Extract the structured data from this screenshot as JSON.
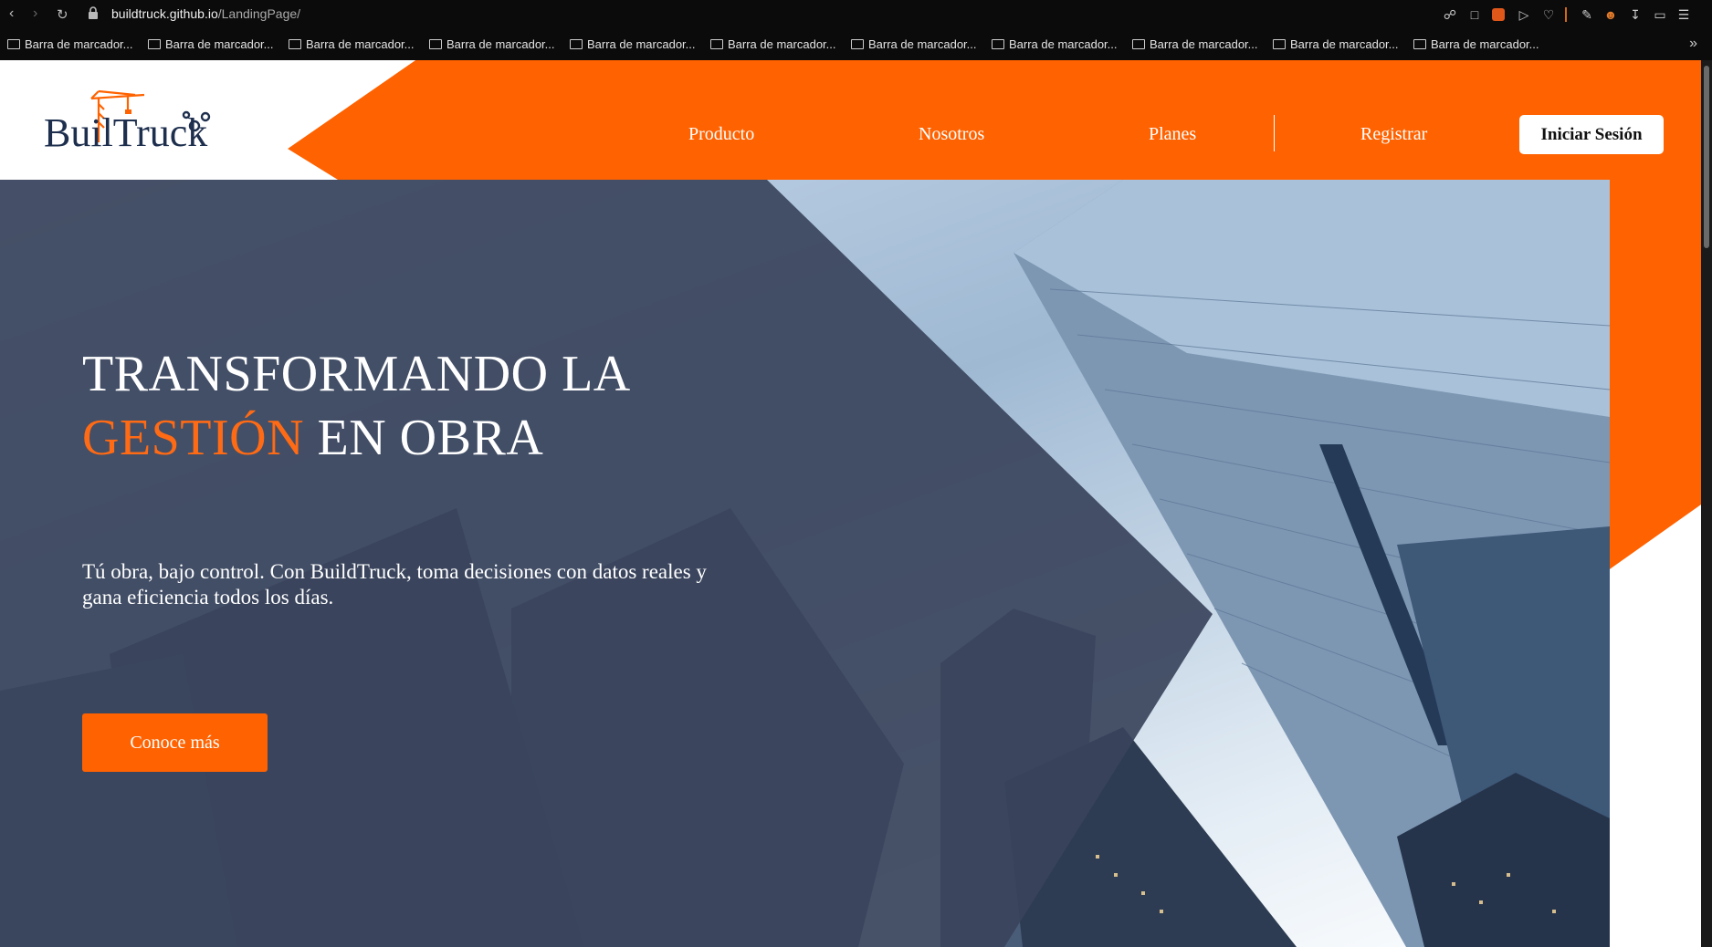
{
  "browser": {
    "url_host": "buildtruck.github.io",
    "url_path": "/LandingPage/",
    "bookmarks": [
      "Barra de marcador...",
      "Barra de marcador...",
      "Barra de marcador...",
      "Barra de marcador...",
      "Barra de marcador...",
      "Barra de marcador...",
      "Barra de marcador...",
      "Barra de marcador...",
      "Barra de marcador...",
      "Barra de marcador...",
      "Barra de marcador..."
    ]
  },
  "header": {
    "logo_text": "BuilTruck",
    "nav": {
      "product": "Producto",
      "about": "Nosotros",
      "plans": "Planes",
      "register": "Registrar"
    },
    "login_label": "Iniciar Sesión"
  },
  "hero": {
    "title_line1": "TRANSFORMANDO LA",
    "title_accent": "GESTIÓN",
    "title_line2_rest": " EN OBRA",
    "subtitle": "Tú obra, bajo control. Con BuildTruck, toma decisiones con datos reales y gana eficiencia todos los días.",
    "cta_label": "Conoce más"
  },
  "colors": {
    "brand_orange": "#ff6200",
    "overlay_navy": "#3a445c",
    "logo_navy": "#1e2f4e"
  }
}
